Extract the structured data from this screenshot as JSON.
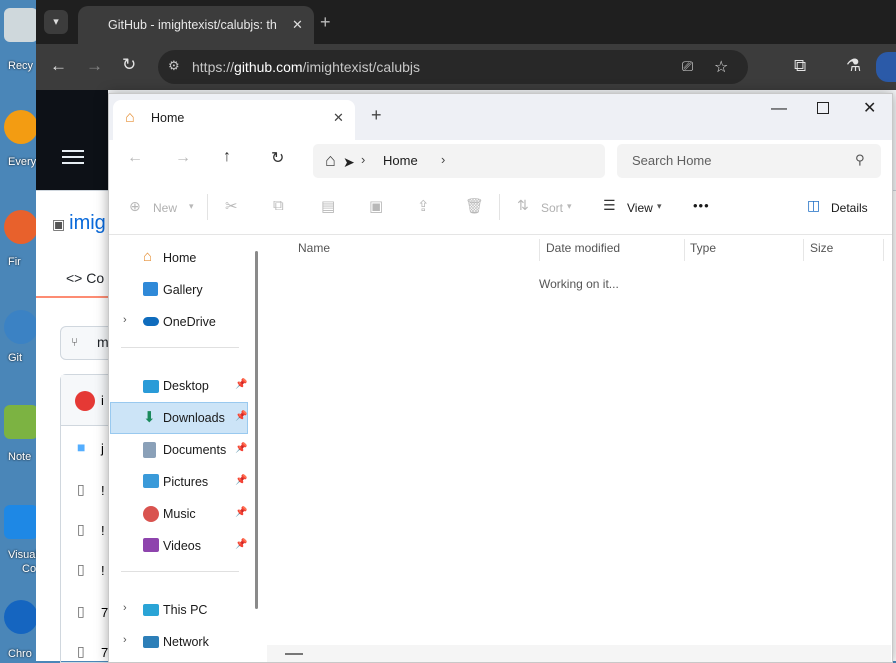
{
  "desktop": {
    "icons": [
      {
        "label": "Recy",
        "icon": "recycle-bin-icon",
        "color": "#cfd8dc"
      },
      {
        "label": "Every",
        "icon": "everything-icon",
        "color": "#f39c12"
      },
      {
        "label": "Fir",
        "icon": "firefox-icon",
        "color": "#e8612c"
      },
      {
        "label": "Git",
        "icon": "git-icon",
        "color": "#3b82c4"
      },
      {
        "label": "Note",
        "icon": "notepad-icon",
        "color": "#7cb342"
      },
      {
        "label": "Visual",
        "label2": "Co",
        "icon": "vscode-icon",
        "color": "#1e88e5"
      },
      {
        "label": "Chro",
        "icon": "chrome-icon",
        "color": "#1565c0"
      }
    ]
  },
  "browser": {
    "tab_title": "GitHub - imightexist/calubjs: th",
    "url_prefix": "https://",
    "url_host": "github.com",
    "url_path": "/imightexist/calubjs",
    "repo_fragment": "imig",
    "code_tab_fragment": "Co",
    "branch_fragment": "m",
    "file_fragments": [
      "i",
      "j",
      "!",
      "!",
      "!",
      "7",
      "7"
    ]
  },
  "explorer": {
    "tab_title": "Home",
    "breadcrumb": "Home",
    "search_placeholder": "Search Home",
    "toolbar": {
      "new_label": "New",
      "sort_label": "Sort",
      "view_label": "View",
      "more_label": "•••",
      "details_label": "Details"
    },
    "columns": [
      "Name",
      "Date modified",
      "Type",
      "Size"
    ],
    "status": "Working on it...",
    "sidebar": {
      "top": [
        {
          "label": "Home",
          "icon": "home-icon"
        },
        {
          "label": "Gallery",
          "icon": "gallery-icon"
        },
        {
          "label": "OneDrive",
          "icon": "onedrive-icon"
        }
      ],
      "pinned": [
        {
          "label": "Desktop",
          "icon": "desktop-folder-icon"
        },
        {
          "label": "Downloads",
          "icon": "downloads-icon"
        },
        {
          "label": "Documents",
          "icon": "documents-icon"
        },
        {
          "label": "Pictures",
          "icon": "pictures-icon"
        },
        {
          "label": "Music",
          "icon": "music-icon"
        },
        {
          "label": "Videos",
          "icon": "videos-icon"
        }
      ],
      "bottom": [
        {
          "label": "This PC",
          "icon": "this-pc-icon"
        },
        {
          "label": "Network",
          "icon": "network-icon"
        }
      ]
    }
  }
}
